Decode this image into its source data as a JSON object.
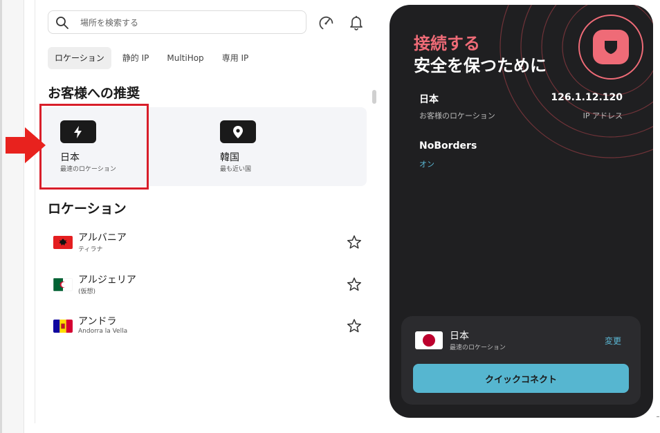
{
  "search": {
    "placeholder": "場所を検索する"
  },
  "header_icons": [
    "speedometer-icon",
    "bell-icon"
  ],
  "tabs": [
    {
      "label": "ロケーション",
      "active": true
    },
    {
      "label": "静的 IP",
      "active": false
    },
    {
      "label": "MultiHop",
      "active": false
    },
    {
      "label": "専用 IP",
      "active": false
    }
  ],
  "recommendations": {
    "title": "お客様への推奨",
    "items": [
      {
        "name": "日本",
        "sub": "最速のロケーション",
        "icon": "lightning-icon"
      },
      {
        "name": "韓国",
        "sub": "最も近い国",
        "icon": "location-pin-icon"
      }
    ]
  },
  "locations": {
    "title": "ロケーション",
    "items": [
      {
        "name": "アルバニア",
        "sub": "ティラナ",
        "flag": "albania"
      },
      {
        "name": "アルジェリア",
        "sub": "(仮想)",
        "flag": "algeria"
      },
      {
        "name": "アンドラ",
        "sub": "Andorra la Vella",
        "flag": "andorra"
      }
    ]
  },
  "vpn": {
    "title_line1": "接続する",
    "title_line2": "安全を保つために",
    "country": "日本",
    "country_sub": "お客様のロケーション",
    "ip": "126.1.12.120",
    "ip_label": "IP アドレス",
    "feature_name": "NoBorders",
    "feature_status": "オン",
    "bottom": {
      "name": "日本",
      "sub": "最速のロケーション",
      "change": "変更",
      "quick_connect": "クイックコネクト"
    }
  },
  "colors": {
    "accent_red": "#ef6b77",
    "accent_blue": "#56b6d0",
    "panel_dark": "#1f1f21",
    "highlight_red": "#d81e2a"
  }
}
